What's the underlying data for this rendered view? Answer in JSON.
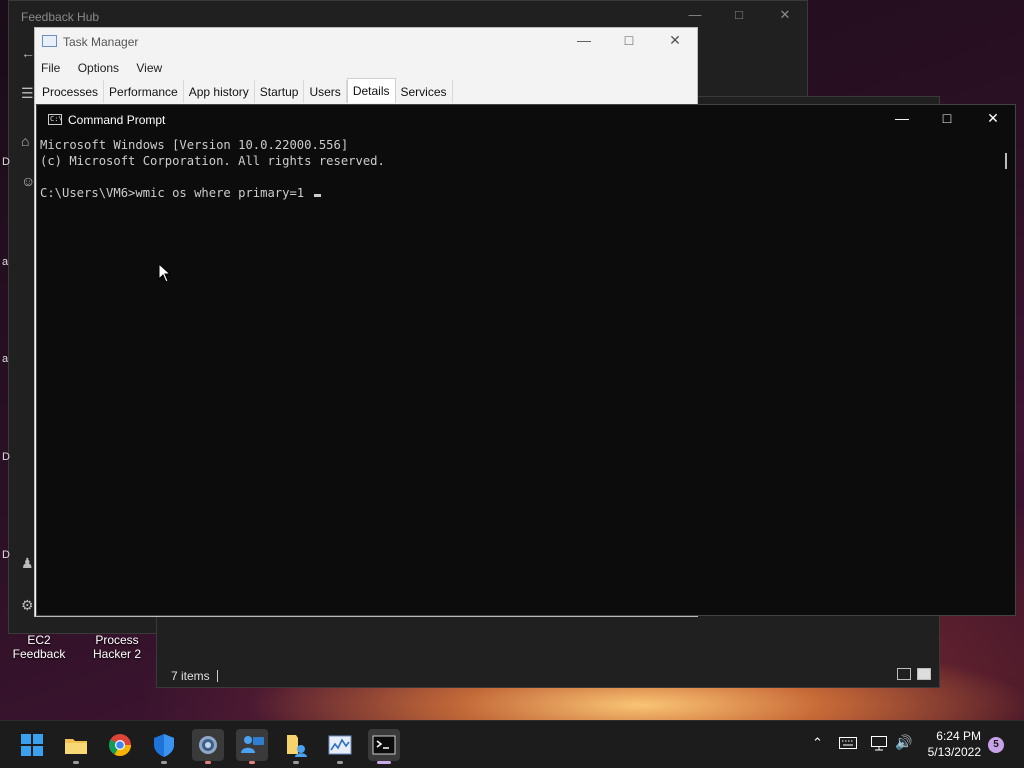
{
  "feedback_hub": {
    "title": "Feedback Hub"
  },
  "explorer": {
    "status": "7 items"
  },
  "left_edge_letters": [
    "D",
    "a",
    "a",
    "D",
    "D"
  ],
  "task_manager": {
    "title": "Task Manager",
    "menu": [
      "File",
      "Options",
      "View"
    ],
    "tabs": [
      "Processes",
      "Performance",
      "App history",
      "Startup",
      "Users",
      "Details",
      "Services"
    ],
    "active_tab": "Details"
  },
  "command_prompt": {
    "title": "Command Prompt",
    "icon_text": "C:\\",
    "lines": [
      "Microsoft Windows [Version 10.0.22000.556]",
      "(c) Microsoft Corporation. All rights reserved.",
      "",
      "C:\\Users\\VM6>wmic os where primary=1 "
    ]
  },
  "desktop_icons": [
    {
      "label": "EC2 Feedback"
    },
    {
      "label": "Process Hacker 2"
    }
  ],
  "taskbar": {
    "apps": [
      {
        "name": "start-icon"
      },
      {
        "name": "file-explorer-icon"
      },
      {
        "name": "chrome-icon"
      },
      {
        "name": "defender-icon"
      },
      {
        "name": "settings-icon"
      },
      {
        "name": "feedback-hub-icon"
      },
      {
        "name": "folder-user-icon"
      },
      {
        "name": "task-manager-icon"
      },
      {
        "name": "command-prompt-icon"
      }
    ],
    "time": "6:24 PM",
    "date": "5/13/2022",
    "notification_count": "5"
  },
  "colors": {
    "accent": "#c7a2e8",
    "console_bg": "#0c0c0c",
    "console_fg": "#cccccc"
  }
}
